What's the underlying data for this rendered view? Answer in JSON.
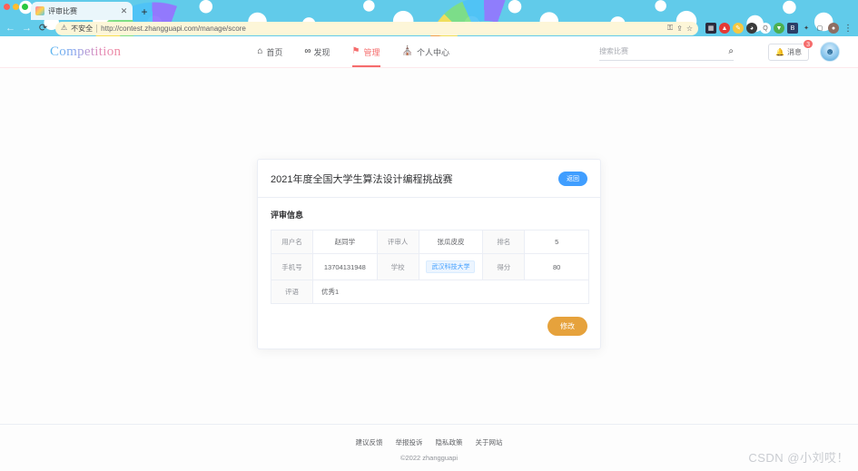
{
  "browser": {
    "tab": {
      "title": "评审比赛",
      "close_label": "✕",
      "favicon": "rainbow-favicon"
    },
    "new_tab_label": "+",
    "nav": {
      "back": "←",
      "forward": "→",
      "reload": "⟳"
    },
    "omnibox": {
      "security_icon": "warning-triangle-icon",
      "security_label": "不安全",
      "url": "http://contest.zhangguapi.com/manage/score",
      "actions": [
        "key-icon",
        "share-icon",
        "star-icon"
      ]
    },
    "extensions": [
      {
        "name": "extension-dark",
        "color": "#2b2b3d",
        "glyph": "▦"
      },
      {
        "name": "extension-red",
        "color": "#e53935",
        "glyph": "▲"
      },
      {
        "name": "extension-yellow",
        "color": "#f5c842",
        "glyph": "✎"
      },
      {
        "name": "extension-panda",
        "color": "#3a3a3a",
        "glyph": "◕"
      },
      {
        "name": "extension-qq",
        "color": "#ffffff",
        "glyph": "Q"
      },
      {
        "name": "extension-green",
        "color": "#4caf50",
        "glyph": "▼"
      },
      {
        "name": "extension-navy",
        "color": "#2c3e66",
        "glyph": "B"
      },
      {
        "name": "extension-puzzle",
        "color": "#5f6368",
        "glyph": "✦"
      },
      {
        "name": "extension-sidepanel",
        "color": "#5f6368",
        "glyph": "▢"
      },
      {
        "name": "profile-avatar",
        "color": "#8d6e63",
        "glyph": "●"
      }
    ],
    "menu_label": "⋮"
  },
  "header": {
    "brand": "Competition",
    "nav_items": [
      {
        "label": "首页",
        "icon": "home-icon",
        "glyph": "⌂",
        "active": false
      },
      {
        "label": "发现",
        "icon": "discover-icon",
        "glyph": "∞",
        "active": false
      },
      {
        "label": "管理",
        "icon": "flag-icon",
        "glyph": "⚑",
        "active": true
      },
      {
        "label": "个人中心",
        "icon": "user-center-icon",
        "glyph": "⛪",
        "active": false
      }
    ],
    "search": {
      "placeholder": "搜索比赛",
      "value": "",
      "icon": "search-icon"
    },
    "message_button": {
      "label": "消息",
      "icon": "bell-icon",
      "badge": "3"
    },
    "avatar": {
      "name": "user-avatar",
      "glyph": "☻"
    }
  },
  "card": {
    "title": "2021年度全国大学生算法设计编程挑战赛",
    "back_button": "返回",
    "section_title": "评审信息",
    "rows": [
      {
        "cells": [
          {
            "type": "label",
            "text": "用户名"
          },
          {
            "type": "value",
            "text": "赵同学"
          },
          {
            "type": "label",
            "text": "评审人"
          },
          {
            "type": "value",
            "text": "张瓜皮皮"
          },
          {
            "type": "label",
            "text": "排名"
          },
          {
            "type": "value-accent",
            "text": "5"
          }
        ]
      },
      {
        "cells": [
          {
            "type": "label",
            "text": "手机号"
          },
          {
            "type": "value",
            "text": "13704131948"
          },
          {
            "type": "label",
            "text": "学校"
          },
          {
            "type": "tag",
            "text": "武汉科技大学"
          },
          {
            "type": "label",
            "text": "得分"
          },
          {
            "type": "value",
            "text": "80"
          }
        ]
      },
      {
        "cells": [
          {
            "type": "label",
            "text": "评语"
          },
          {
            "type": "comment",
            "text": "优秀1"
          }
        ]
      }
    ],
    "edit_button": "修改"
  },
  "footer": {
    "links": [
      "建议反馈",
      "举报投诉",
      "隐私政策",
      "关于网站"
    ],
    "copyright": "©2022 zhangguapi"
  },
  "watermark": "CSDN @小刘哎！"
}
